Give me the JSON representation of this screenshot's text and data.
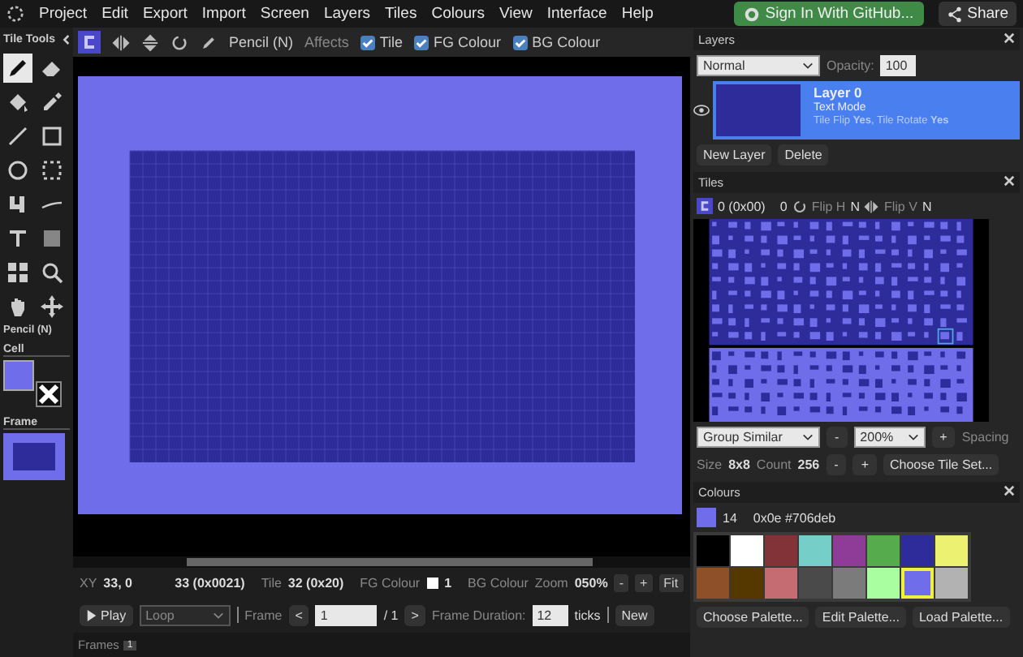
{
  "menu": [
    "Project",
    "Edit",
    "Export",
    "Import",
    "Screen",
    "Layers",
    "Tiles",
    "Colours",
    "View",
    "Interface",
    "Help"
  ],
  "signin_button": "Sign In With GitHub...",
  "share_button": "Share",
  "tool_panel": {
    "title": "Tile Tools",
    "tools": [
      {
        "kind": "pencil",
        "selected": true
      },
      {
        "kind": "eraser",
        "selected": false
      },
      {
        "kind": "fill",
        "selected": false
      },
      {
        "kind": "picker",
        "selected": false
      },
      {
        "kind": "line",
        "selected": false
      },
      {
        "kind": "rect",
        "selected": false
      },
      {
        "kind": "ellipse",
        "selected": false
      },
      {
        "kind": "select",
        "selected": false
      },
      {
        "kind": "block",
        "selected": false
      },
      {
        "kind": "curve",
        "selected": false
      },
      {
        "kind": "text",
        "selected": false
      },
      {
        "kind": "dither",
        "selected": false
      },
      {
        "kind": "grid",
        "selected": false
      },
      {
        "kind": "zoom",
        "selected": false
      },
      {
        "kind": "hand",
        "selected": false
      },
      {
        "kind": "move",
        "selected": false
      }
    ],
    "current_tool": "Pencil (N)",
    "cell_label": "Cell",
    "frame_label": "Frame"
  },
  "toolbar": {
    "tool_name": "Pencil (N)",
    "affects_label": "Affects",
    "affects": [
      {
        "label": "Tile",
        "checked": true
      },
      {
        "label": "FG Colour",
        "checked": true
      },
      {
        "label": "BG Colour",
        "checked": true
      }
    ]
  },
  "status_bar": {
    "xy_label": "XY",
    "xy": "33, 0",
    "char": "33 (0x0021)",
    "tile_label": "Tile",
    "tile": "32 (0x20)",
    "fg_label": "FG Colour",
    "fg_value": "1",
    "bg_label": "BG Colour",
    "zoom_label": "Zoom",
    "zoom": "050%",
    "zoom_buttons": [
      "-",
      "+",
      "Fit"
    ]
  },
  "animation": {
    "play": "Play",
    "mode": "Loop",
    "frame_label": "Frame",
    "prev": "<",
    "frame": "1",
    "total": "/ 1",
    "next": ">",
    "duration_label": "Frame Duration:",
    "duration": "12",
    "ticks": "ticks",
    "new_button": "New"
  },
  "frames": {
    "label": "Frames",
    "items": [
      "1"
    ]
  },
  "layers": {
    "title": "Layers",
    "blend": "Normal",
    "opacity_label": "Opacity:",
    "opacity": "100",
    "items": [
      {
        "name": "Layer 0",
        "mode": "Text Mode",
        "details": "Tile Flip **Yes**, Tile Rotate **Yes**",
        "selected": true,
        "visible": true
      }
    ],
    "new_button": "New Layer",
    "delete_button": "Delete"
  },
  "tiles": {
    "title": "Tiles",
    "tile": "0 (0x00)",
    "value": "0",
    "flip_h_label": "Flip H",
    "flip_h": "N",
    "flip_v_label": "Flip V",
    "flip_v": "N",
    "group": "Group Similar",
    "zoom": "200%",
    "zoom_minus": "-",
    "zoom_plus": "+",
    "spacing_label": "Spacing",
    "size_label": "Size",
    "size": "8x8",
    "count_label": "Count",
    "count": "256",
    "count_minus": "-",
    "count_plus": "+",
    "choose_button": "Choose Tile Set..."
  },
  "colours": {
    "title": "Colours",
    "index": "14",
    "hex": "0x0e #706deb",
    "swatches": [
      {
        "color": "#000000",
        "selected": false
      },
      {
        "color": "#ffffff",
        "selected": false
      },
      {
        "color": "#813338",
        "selected": false
      },
      {
        "color": "#75cec8",
        "selected": false
      },
      {
        "color": "#8e3c97",
        "selected": false
      },
      {
        "color": "#56ac4d",
        "selected": false
      },
      {
        "color": "#2e2c9b",
        "selected": false
      },
      {
        "color": "#edf171",
        "selected": false
      },
      {
        "color": "#8e5029",
        "selected": false
      },
      {
        "color": "#553800",
        "selected": false
      },
      {
        "color": "#c46c71",
        "selected": false
      },
      {
        "color": "#4a4a4a",
        "selected": false
      },
      {
        "color": "#7b7b7b",
        "selected": false
      },
      {
        "color": "#a9ff9f",
        "selected": false
      },
      {
        "color": "#706deb",
        "selected": true
      },
      {
        "color": "#b2b2b2",
        "selected": false
      }
    ],
    "buttons": [
      "Choose Palette...",
      "Edit Palette...",
      "Load Palette..."
    ]
  }
}
